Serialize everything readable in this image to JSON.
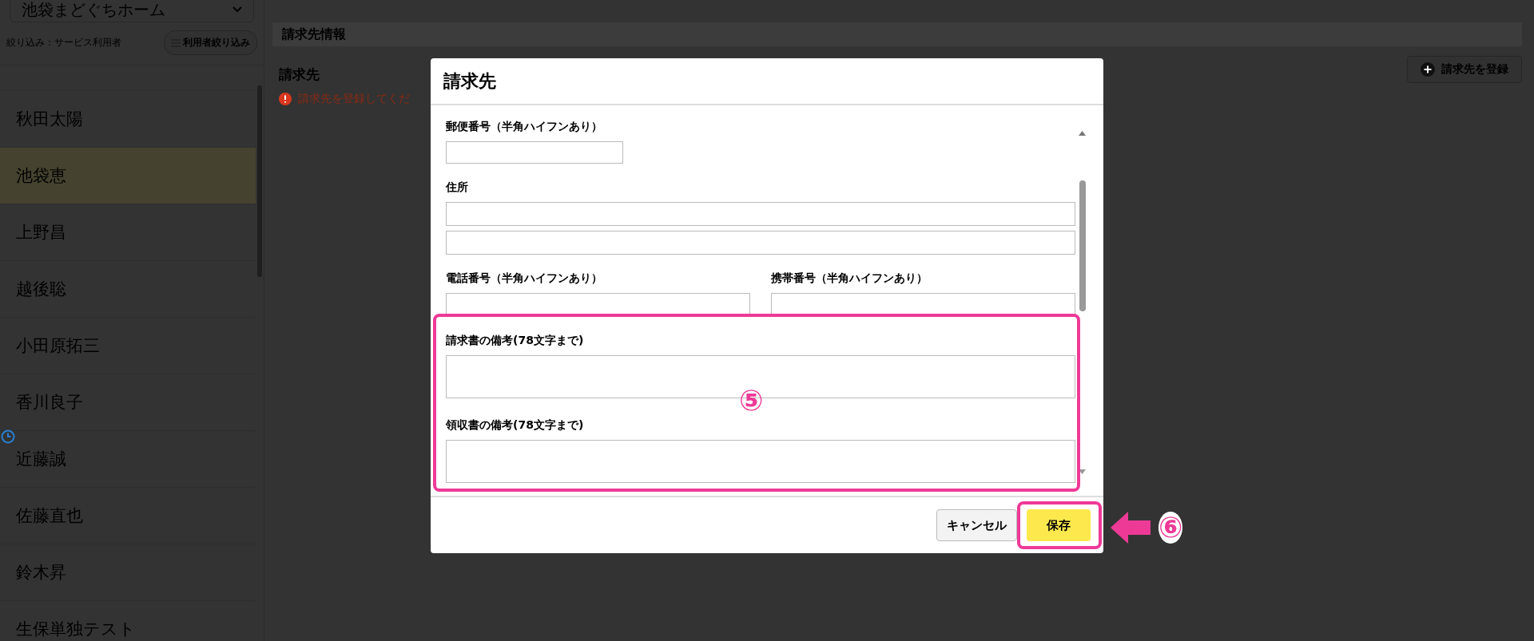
{
  "sidebar": {
    "facility": "池袋まどぐちホーム",
    "filter_text": "絞り込み：サービス利用者",
    "filter_button": "利用者絞り込み",
    "users": [
      {
        "name": "秋田太陽",
        "selected": false
      },
      {
        "name": "池袋恵",
        "selected": true
      },
      {
        "name": "上野昌",
        "selected": false
      },
      {
        "name": "越後聡",
        "selected": false
      },
      {
        "name": "小田原拓三",
        "selected": false
      },
      {
        "name": "香川良子",
        "selected": false
      },
      {
        "name": "近藤誠",
        "selected": false
      },
      {
        "name": "佐藤直也",
        "selected": false
      },
      {
        "name": "鈴木昇",
        "selected": false
      },
      {
        "name": "生保単独テスト",
        "selected": false
      }
    ]
  },
  "main": {
    "header": "請求先情報",
    "section_title": "請求先",
    "error": "請求先を登録してくだ",
    "register_button": "請求先を登録"
  },
  "modal": {
    "title": "請求先",
    "fields": [
      {
        "kind": "short",
        "label": "郵便番号（半角ハイフンあり）"
      },
      {
        "kind": "address",
        "label": "住所"
      },
      {
        "kind": "pair",
        "items": [
          {
            "label": "電話番号（半角ハイフンあり）"
          },
          {
            "label": "携帯番号（半角ハイフンあり）"
          }
        ]
      },
      {
        "kind": "textarea",
        "label": "請求書の備考(78文字まで)"
      },
      {
        "kind": "textarea",
        "label": "領収書の備考(78文字まで)"
      }
    ],
    "cancel_button": "キャンセル",
    "save_button": "保存"
  },
  "annotations": [
    {
      "label": "⑤"
    },
    {
      "label": "⑥"
    }
  ]
}
